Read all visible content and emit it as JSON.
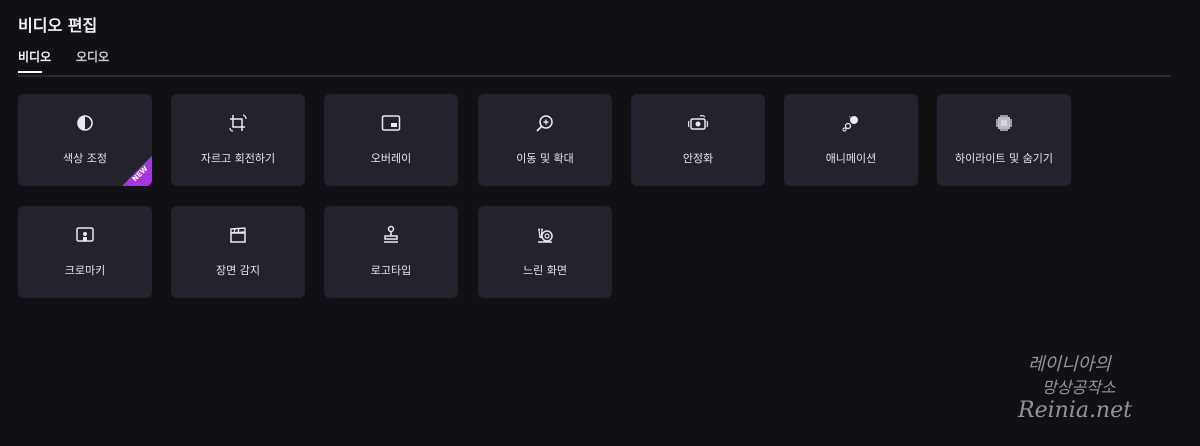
{
  "page": {
    "title": "비디오 편집"
  },
  "tabs": [
    {
      "label": "비디오",
      "active": true
    },
    {
      "label": "오디오",
      "active": false
    }
  ],
  "tools_row1": [
    {
      "label": "색상 조정",
      "icon": "color-adjust-icon",
      "badge": "NEW"
    },
    {
      "label": "자르고 회전하기",
      "icon": "crop-rotate-icon"
    },
    {
      "label": "오버레이",
      "icon": "overlay-icon"
    },
    {
      "label": "이동 및 확대",
      "icon": "pan-zoom-icon"
    },
    {
      "label": "안정화",
      "icon": "stabilize-icon"
    },
    {
      "label": "애니메이션",
      "icon": "animation-icon"
    },
    {
      "label": "하이라이트 및 숨기기",
      "icon": "highlight-hide-icon"
    }
  ],
  "tools_row2": [
    {
      "label": "크로마키",
      "icon": "chroma-key-icon"
    },
    {
      "label": "장면 감지",
      "icon": "scene-detect-icon"
    },
    {
      "label": "로고타입",
      "icon": "logotype-stamp-icon"
    },
    {
      "label": "느린 화면",
      "icon": "slow-motion-snail-icon"
    }
  ],
  "watermark": {
    "line1": "레이니아의",
    "line2": "망상공작소",
    "line3": "Reinia.net"
  },
  "colors": {
    "background": "#111115",
    "card": "#22232d",
    "badge": "#a535dc"
  }
}
